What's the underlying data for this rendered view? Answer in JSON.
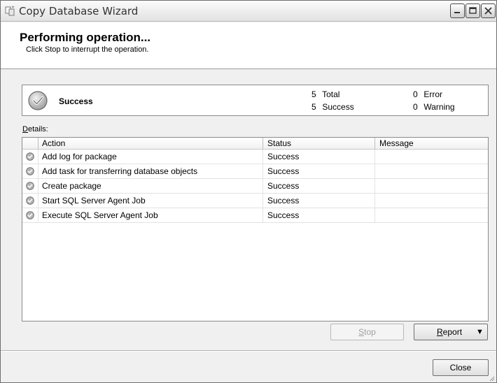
{
  "window": {
    "title": "Copy Database Wizard"
  },
  "header": {
    "title": "Performing operation...",
    "subtitle": "Click Stop to interrupt the operation."
  },
  "summary": {
    "status": "Success",
    "total_count": "5",
    "total_label": "Total",
    "success_count": "5",
    "success_label": "Success",
    "error_count": "0",
    "error_label": "Error",
    "warning_count": "0",
    "warning_label": "Warning"
  },
  "details": {
    "label_prefix": "D",
    "label_rest": "etails:",
    "columns": [
      "Action",
      "Status",
      "Message"
    ],
    "rows": [
      {
        "action": "Add log for package",
        "status": "Success",
        "message": ""
      },
      {
        "action": "Add task for transferring database objects",
        "status": "Success",
        "message": ""
      },
      {
        "action": "Create package",
        "status": "Success",
        "message": ""
      },
      {
        "action": "Start SQL Server Agent Job",
        "status": "Success",
        "message": ""
      },
      {
        "action": "Execute SQL Server Agent Job",
        "status": "Success",
        "message": ""
      }
    ]
  },
  "buttons": {
    "stop_accel": "S",
    "stop_rest": "top",
    "report_accel": "R",
    "report_rest": "eport",
    "report_arrow": "▼",
    "close": "Close"
  },
  "icons": {
    "app": "wizard-icon",
    "status": "check-circle-icon"
  }
}
